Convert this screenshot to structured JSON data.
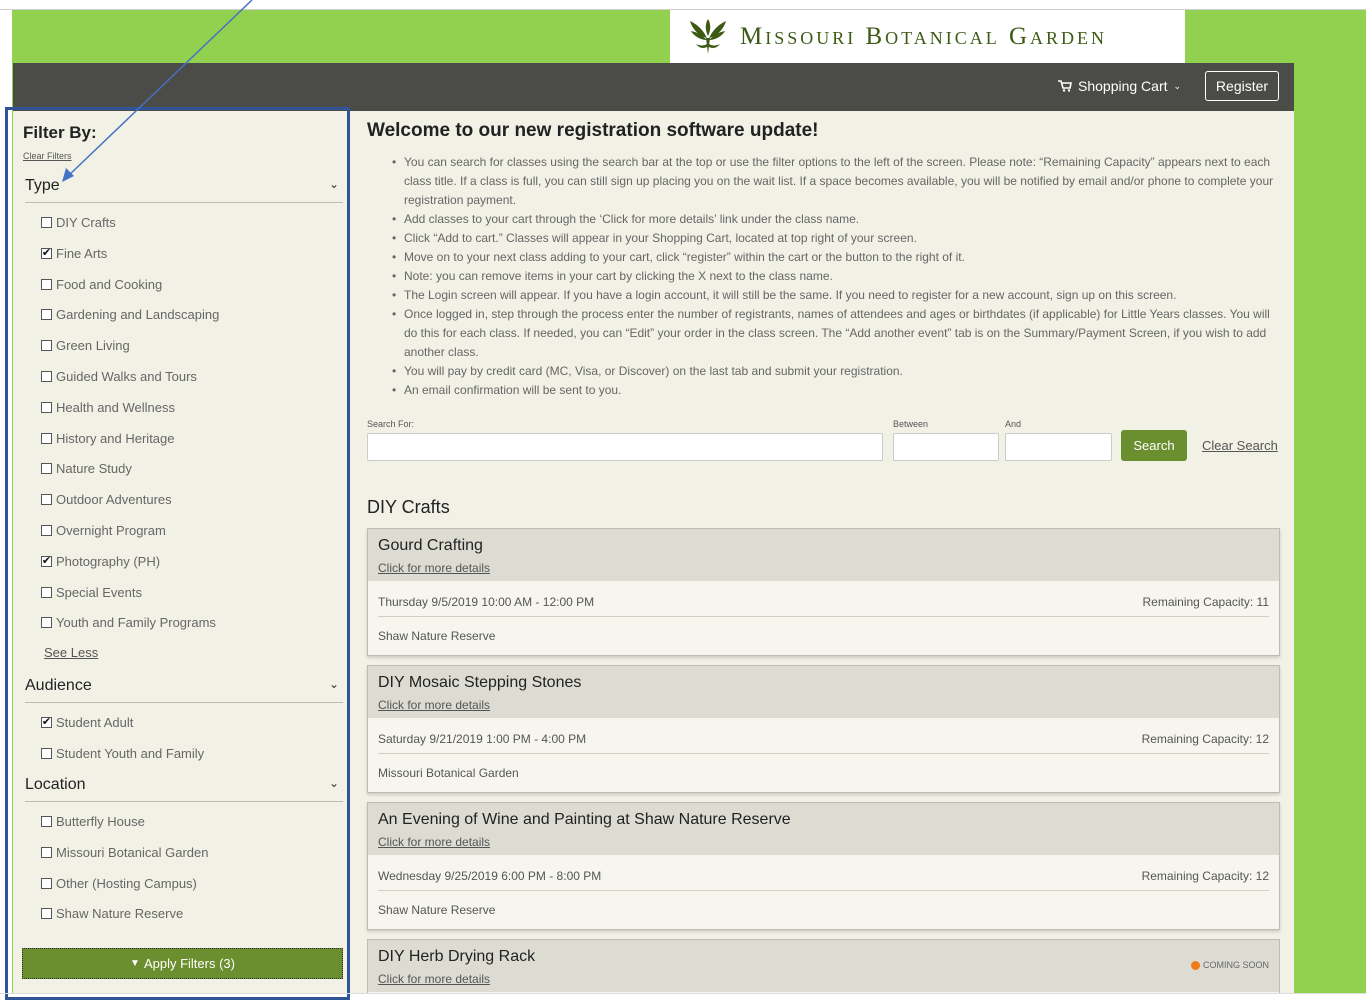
{
  "header": {
    "logo_text": "Missouri Botanical Garden",
    "cart_label": "Shopping Cart",
    "register_label": "Register"
  },
  "sidebar": {
    "title": "Filter By:",
    "clear_filters": "Clear Filters",
    "type_heading": "Type",
    "type_items": [
      {
        "label": "DIY Crafts",
        "checked": false
      },
      {
        "label": "Fine Arts",
        "checked": true
      },
      {
        "label": "Food and Cooking",
        "checked": false
      },
      {
        "label": "Gardening and Landscaping",
        "checked": false
      },
      {
        "label": "Green Living",
        "checked": false
      },
      {
        "label": "Guided Walks and Tours",
        "checked": false
      },
      {
        "label": "Health and Wellness",
        "checked": false
      },
      {
        "label": "History and Heritage",
        "checked": false
      },
      {
        "label": "Nature Study",
        "checked": false
      },
      {
        "label": "Outdoor Adventures",
        "checked": false
      },
      {
        "label": "Overnight Program",
        "checked": false
      },
      {
        "label": "Photography (PH)",
        "checked": true
      },
      {
        "label": "Special Events",
        "checked": false
      },
      {
        "label": "Youth and Family Programs",
        "checked": false
      }
    ],
    "see_less": "See Less",
    "audience_heading": "Audience",
    "audience_items": [
      {
        "label": "Student Adult",
        "checked": true
      },
      {
        "label": "Student Youth and Family",
        "checked": false
      }
    ],
    "location_heading": "Location",
    "location_items": [
      {
        "label": "Butterfly House",
        "checked": false
      },
      {
        "label": "Missouri Botanical Garden",
        "checked": false
      },
      {
        "label": "Other (Hosting Campus)",
        "checked": false
      },
      {
        "label": "Shaw Nature Reserve",
        "checked": false
      }
    ],
    "apply_label": "Apply Filters (3)"
  },
  "main": {
    "welcome_title": "Welcome to our new registration software update!",
    "bullets": [
      "You can search for classes using the search bar at the top or use the filter options to the left of the screen. Please note: “Remaining Capacity” appears next to each class title. If a class is full, you can still sign up placing you on the wait list. If a space becomes available, you will be notified by email and/or phone to complete your registration payment.",
      "Add classes to your cart through the ‘Click for more details’ link under the class name.",
      "Click “Add to cart.” Classes will appear in your Shopping Cart, located at top right of your screen.",
      "Move on to your next class adding to your cart, click “register” within the cart or the button to the right of it.",
      "Note: you can remove items in your cart by clicking the X next to the class name.",
      "The Login screen will appear. If you have a login account, it will still be the same. If you need to register for a new account, sign up on this screen.",
      "Once logged in, step through the process enter the number of registrants, names of attendees and ages or birthdates (if applicable) for Little Years classes. You will do this for each class. If needed, you can “Edit” your order in the class screen. The “Add another event” tab is on the Summary/Payment Screen, if you wish to add another class.",
      "You will pay by credit card (MC, Visa, or Discover) on the last tab and submit your registration.",
      "An email confirmation will be sent to you."
    ],
    "search": {
      "search_for_label": "Search For:",
      "between_label": "Between",
      "and_label": "And",
      "search_value": "",
      "between_value": "",
      "and_value": "",
      "search_button": "Search",
      "clear_search": "Clear Search"
    },
    "category": "DIY Crafts",
    "events": [
      {
        "title": "Gourd Crafting",
        "link": "Click for more details",
        "date": "Thursday 9/5/2019 10:00 AM - 12:00 PM",
        "capacity": "Remaining Capacity: 11",
        "location": "Shaw Nature Reserve"
      },
      {
        "title": "DIY Mosaic Stepping Stones",
        "link": "Click for more details",
        "date": "Saturday 9/21/2019 1:00 PM - 4:00 PM",
        "capacity": "Remaining Capacity: 12",
        "location": "Missouri Botanical Garden"
      },
      {
        "title": "An Evening of Wine and Painting at Shaw Nature Reserve",
        "link": "Click for more details",
        "date": "Wednesday 9/25/2019 6:00 PM - 8:00 PM",
        "capacity": "Remaining Capacity: 12",
        "location": "Shaw Nature Reserve"
      },
      {
        "title": "DIY Herb Drying Rack",
        "link": "Click for more details",
        "status": "COMING SOON"
      }
    ]
  },
  "colors": {
    "page_green": "#92d050",
    "navbar": "#4b4c47",
    "content_bg": "#f2f1e6",
    "button_green": "#6b8e2e",
    "annotation_blue": "#2f5597",
    "coming_soon_dot": "#f07a1a"
  }
}
